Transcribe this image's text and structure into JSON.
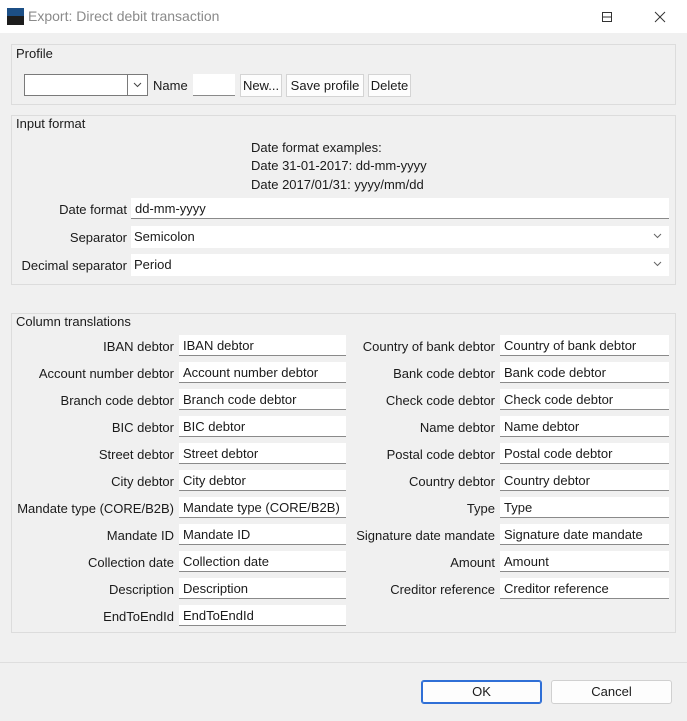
{
  "window": {
    "title": "Export: Direct debit transaction",
    "minimize_icon": "minimize-icon",
    "maximize_icon": "maximize-icon",
    "close_icon": "close-icon"
  },
  "profile": {
    "group_label": "Profile",
    "combo_value": "",
    "name_label": "Name",
    "name_value": "",
    "new_label": "New...",
    "save_label": "Save profile",
    "delete_label": "Delete"
  },
  "input_format": {
    "group_label": "Input format",
    "examples": [
      "Date format examples:",
      "Date 31-01-2017: dd-mm-yyyy",
      "Date 2017/01/31: yyyy/mm/dd"
    ],
    "date_format_label": "Date format",
    "date_format_value": "dd-mm-yyyy",
    "separator_label": "Separator",
    "separator_value": "Semicolon",
    "decimal_label": "Decimal separator",
    "decimal_value": "Period"
  },
  "columns": {
    "group_label": "Column translations",
    "left": [
      {
        "label": "IBAN debtor",
        "value": "IBAN debtor"
      },
      {
        "label": "Account number debtor",
        "value": "Account number debtor"
      },
      {
        "label": "Branch code debtor",
        "value": "Branch code debtor"
      },
      {
        "label": "BIC debtor",
        "value": "BIC debtor"
      },
      {
        "label": "Street debtor",
        "value": "Street debtor"
      },
      {
        "label": "City debtor",
        "value": "City debtor"
      },
      {
        "label": "Mandate type (CORE/B2B)",
        "value": "Mandate type (CORE/B2B)"
      },
      {
        "label": "Mandate ID",
        "value": "Mandate ID"
      },
      {
        "label": "Collection date",
        "value": "Collection date"
      },
      {
        "label": "Description",
        "value": "Description"
      },
      {
        "label": "EndToEndId",
        "value": "EndToEndId"
      }
    ],
    "right": [
      {
        "label": "Country of bank debtor",
        "value": "Country of bank debtor"
      },
      {
        "label": "Bank code debtor",
        "value": "Bank code debtor"
      },
      {
        "label": "Check code debtor",
        "value": "Check code debtor"
      },
      {
        "label": "Name debtor",
        "value": "Name debtor"
      },
      {
        "label": "Postal code debtor",
        "value": "Postal code debtor"
      },
      {
        "label": "Country debtor",
        "value": "Country debtor"
      },
      {
        "label": "Type",
        "value": "Type"
      },
      {
        "label": "Signature date mandate",
        "value": "Signature date mandate"
      },
      {
        "label": "Amount",
        "value": "Amount"
      },
      {
        "label": "Creditor reference",
        "value": "Creditor reference"
      }
    ]
  },
  "footer": {
    "ok_label": "OK",
    "cancel_label": "Cancel"
  }
}
